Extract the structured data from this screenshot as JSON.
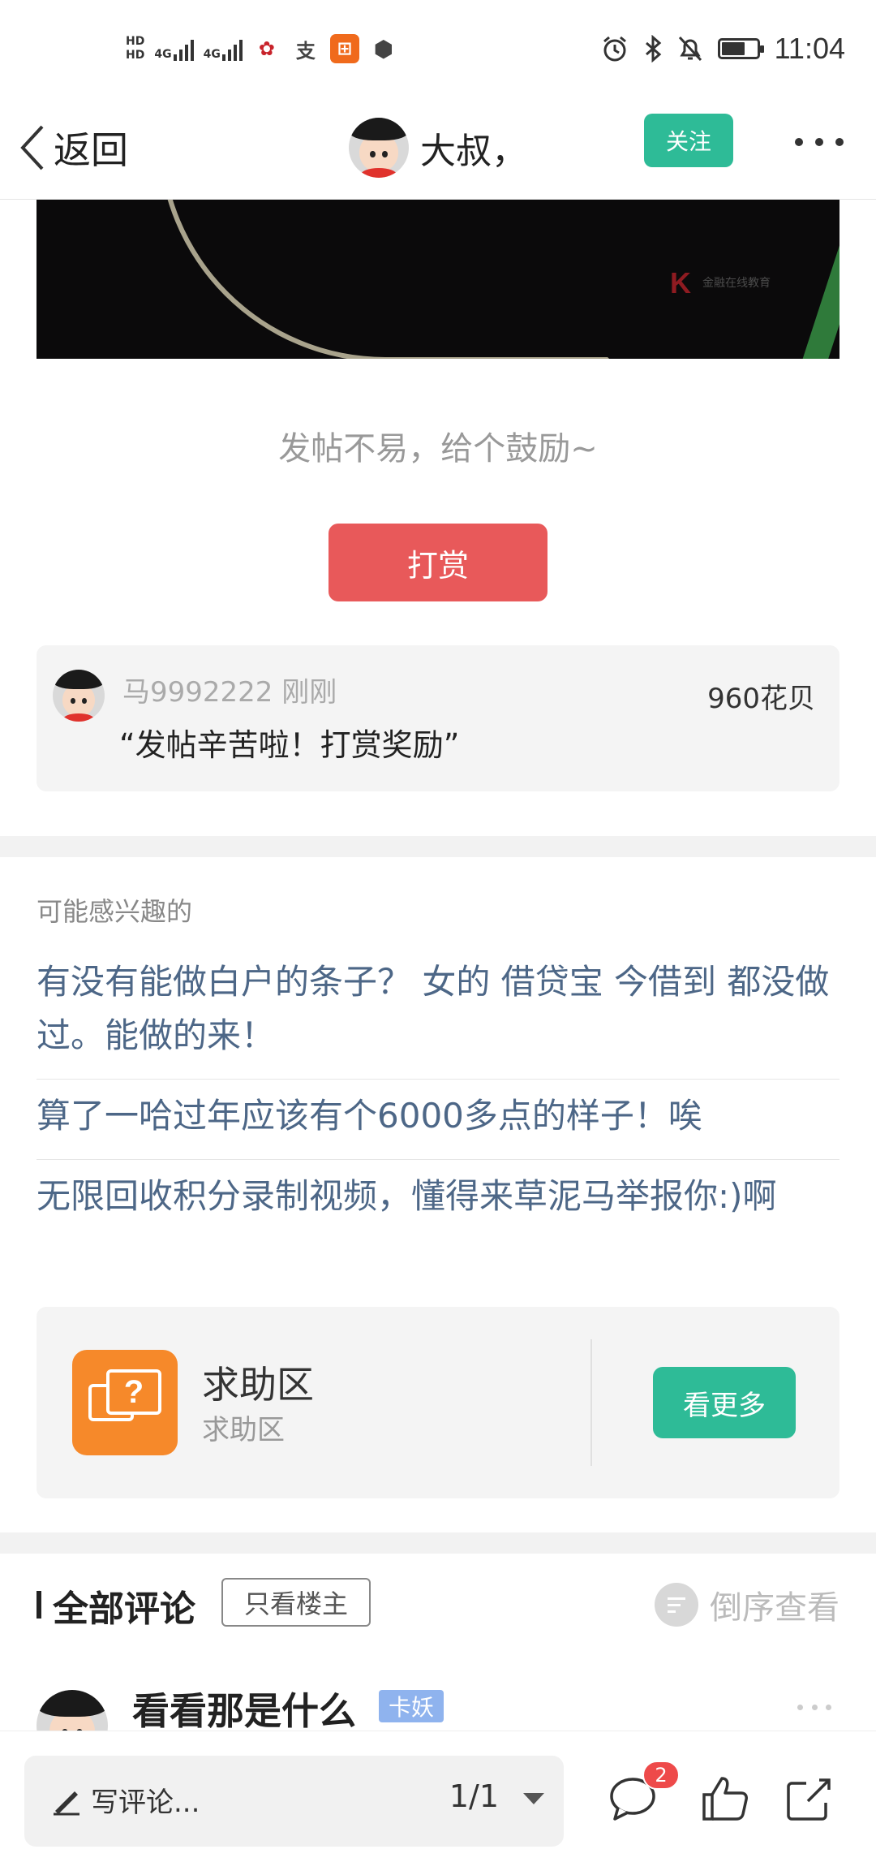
{
  "status_bar": {
    "hd1": "HD",
    "hd2": "HD",
    "net1": "4G",
    "net2": "4G",
    "time": "11:04",
    "battery_level": 0.68
  },
  "nav": {
    "back_label": "返回",
    "user_name": "大叔，",
    "follow_label": "关注"
  },
  "post": {
    "encourage_text": "发帖不易，给个鼓励~",
    "reward_label": "打赏",
    "watermark_text": "金融在线教育"
  },
  "tip": {
    "user": "马9992222",
    "time": "刚刚",
    "amount": "960花贝",
    "message": "“发帖辛苦啦！打赏奖励”"
  },
  "interest": {
    "title": "可能感兴趣的",
    "links": [
      "有没有能做白户的条子？ 女的 借贷宝 今借到 都没做过。能做的来！",
      "算了一哈过年应该有个6000多点的样子！唉",
      "无限回收积分录制视频，懂得来草泥马举报你:)啊"
    ]
  },
  "forum": {
    "name": "求助区",
    "sub": "求助区",
    "more_label": "看更多",
    "icon_glyph": "?"
  },
  "comments": {
    "title": "全部评论",
    "only_op": "只看楼主",
    "reverse": "倒序查看",
    "first": {
      "name": "看看那是什么",
      "badge": "卡妖"
    }
  },
  "bottom_bar": {
    "write_placeholder": "写评论...",
    "page": "1/1",
    "comment_count": "2"
  },
  "colors": {
    "accent_green": "#2ebb97",
    "reward_red": "#e8595a",
    "link_blue": "#4d6787",
    "forum_orange": "#f6892a",
    "badge_blue": "#8fb3ee"
  }
}
